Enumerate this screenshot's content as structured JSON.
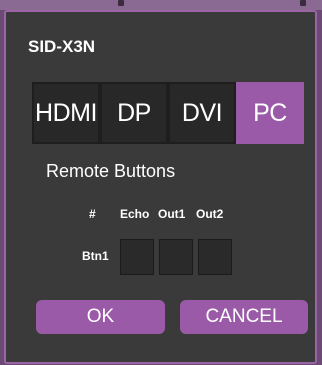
{
  "dialog": {
    "title": "SID-X3N",
    "tabs": [
      {
        "label": "HDMI",
        "active": false
      },
      {
        "label": "DP",
        "active": false
      },
      {
        "label": "DVI",
        "active": false
      },
      {
        "label": "PC",
        "active": true
      }
    ],
    "remote_buttons": {
      "title": "Remote Buttons",
      "columns": [
        "#",
        "Echo",
        "Out1",
        "Out2"
      ],
      "rows": [
        {
          "label": "Btn1",
          "echo": "",
          "out1": "",
          "out2": ""
        }
      ]
    },
    "ok_label": "OK",
    "cancel_label": "CANCEL"
  },
  "colors": {
    "accent": "#9b5aa8",
    "dialog_bg": "#3a3a3a",
    "outer_bg": "#6b4a73"
  }
}
